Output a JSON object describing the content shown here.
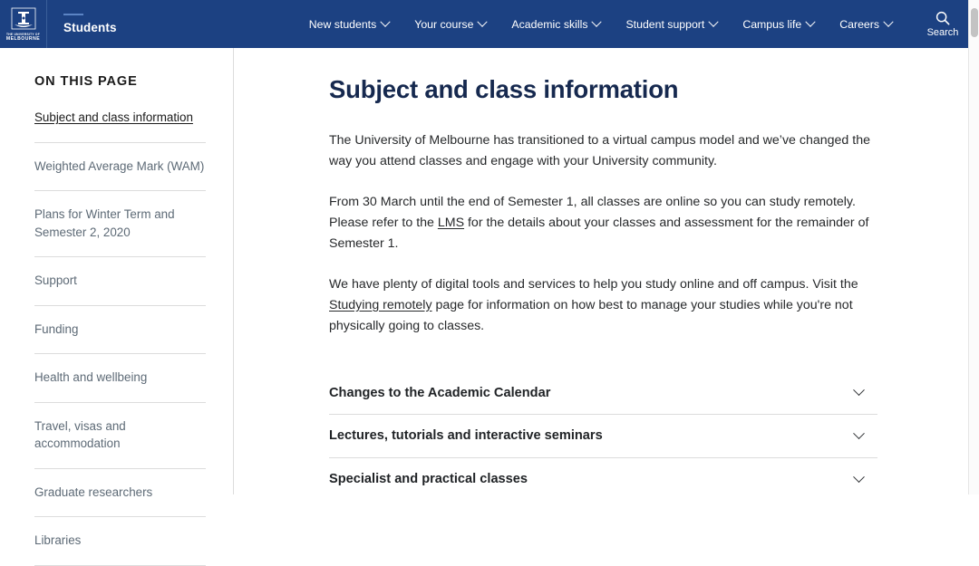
{
  "colors": {
    "header_blue": "#1c4182",
    "heading_navy": "#16294f",
    "body_text": "#27292b",
    "muted_text": "#5d6a76",
    "divider": "#dcdcdc"
  },
  "header": {
    "logo": {
      "icon": "unimelb-crest-icon",
      "line1": "THE UNIVERSITY OF",
      "line2": "MELBOURNE"
    },
    "site_title": "Students",
    "nav_items": [
      {
        "label": "New students",
        "icon": "chevron-down-icon"
      },
      {
        "label": "Your course",
        "icon": "chevron-down-icon"
      },
      {
        "label": "Academic skills",
        "icon": "chevron-down-icon"
      },
      {
        "label": "Student support",
        "icon": "chevron-down-icon"
      },
      {
        "label": "Campus life",
        "icon": "chevron-down-icon"
      },
      {
        "label": "Careers",
        "icon": "chevron-down-icon"
      }
    ],
    "search": {
      "label": "Search",
      "icon": "search-icon"
    }
  },
  "sidebar": {
    "heading": "ON THIS PAGE",
    "items": [
      {
        "label": "Subject and class information",
        "active": true
      },
      {
        "label": "Weighted Average Mark (WAM)",
        "active": false
      },
      {
        "label": "Plans for Winter Term and Semester 2, 2020",
        "active": false
      },
      {
        "label": "Support",
        "active": false
      },
      {
        "label": "Funding",
        "active": false
      },
      {
        "label": "Health and wellbeing",
        "active": false
      },
      {
        "label": "Travel, visas and accommodation",
        "active": false
      },
      {
        "label": "Graduate researchers",
        "active": false
      },
      {
        "label": "Libraries",
        "active": false
      }
    ]
  },
  "main": {
    "title": "Subject and class information",
    "paragraph1": "The University of Melbourne has transitioned to a virtual campus model and we’ve changed the way you attend classes and engage with your University community.",
    "paragraph2_part1": "From 30 March until the end of Semester 1, all classes are online so you can study remotely. Please refer to the ",
    "paragraph2_link": "LMS",
    "paragraph2_part2": " for the details about your classes and assessment for the remainder of Semester 1.",
    "paragraph3_part1": "We have plenty of digital tools and services to help you study online and off campus. Visit the ",
    "paragraph3_link": "Studying remotely",
    "paragraph3_part2": " page for information on how best to manage your studies while you're not physically going to classes.",
    "accordion": [
      {
        "label": "Changes to the Academic Calendar",
        "icon": "chevron-down-icon"
      },
      {
        "label": "Lectures, tutorials and interactive seminars",
        "icon": "chevron-down-icon"
      },
      {
        "label": "Specialist and practical classes",
        "icon": "chevron-down-icon"
      }
    ]
  }
}
